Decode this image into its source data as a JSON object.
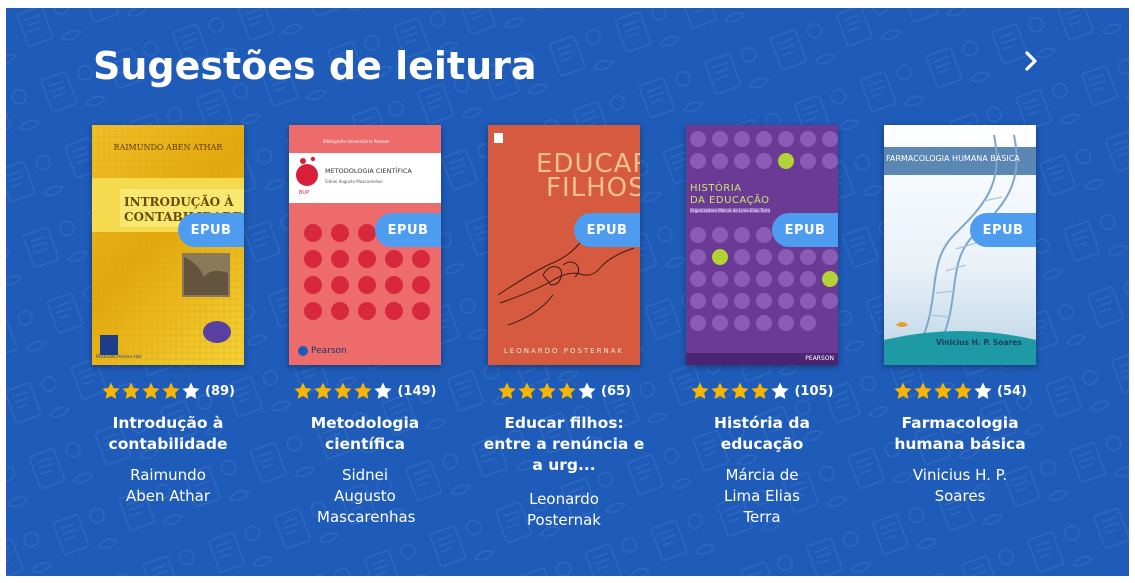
{
  "section": {
    "title": "Sugestões de leitura",
    "next_icon": "chevron-right-icon"
  },
  "colors": {
    "background": "#1f5bb8",
    "epub_badge": "#4d9cf0",
    "star": "#f7b500"
  },
  "books": [
    {
      "badge": "EPUB",
      "rating_stars": 4,
      "rating_count": "(89)",
      "title": "Introdução à contabilidade",
      "author": "Raimundo Aben Athar",
      "cover": {
        "author_line": "RAIMUNDO ABEN ATHAR",
        "title_line1": "INTRODUÇÃO À",
        "title_line2": "CONTABILIDADE",
        "publisher": "PEARSON Prentice Hall"
      }
    },
    {
      "badge": "EPUB",
      "rating_stars": 4,
      "rating_count": "(149)",
      "title": "Metodologia científica",
      "author": "Sidnei Augusto Mascarenhas",
      "cover": {
        "series": "Bibliografia Universitária Pearson",
        "title_line": "METODOLOGIA CIENTÍFICA",
        "author_line": "Sidnei Augusto Mascarenhas",
        "logo": "BUP",
        "publisher": "Pearson"
      }
    },
    {
      "badge": "EPUB",
      "rating_stars": 4,
      "rating_count": "(65)",
      "title": "Educar filhos: entre a renúncia e a urg...",
      "author": "Leonardo Posternak",
      "cover": {
        "title_line1": "EDUCAR",
        "title_line2": "FILHOS",
        "author_line": "LEONARDO POSTERNAK"
      }
    },
    {
      "badge": "EPUB",
      "rating_stars": 4,
      "rating_count": "(105)",
      "title": "História da educação",
      "author": "Márcia de Lima Elias Terra",
      "cover": {
        "title_line1": "HISTÓRIA",
        "title_line2": "DA EDUCAÇÃO",
        "author_line": "Organizadora Márcia de Lima Elias Terra",
        "publisher": "PEARSON"
      }
    },
    {
      "badge": "EPUB",
      "rating_stars": 4,
      "rating_count": "(54)",
      "title": "Farmacologia humana básica",
      "author": "Vinicius H. P. Soares",
      "cover": {
        "title_line": "FARMACOLOGIA HUMANA BÁSICA",
        "author_line": "Vinicius H. P. Soares"
      }
    }
  ]
}
